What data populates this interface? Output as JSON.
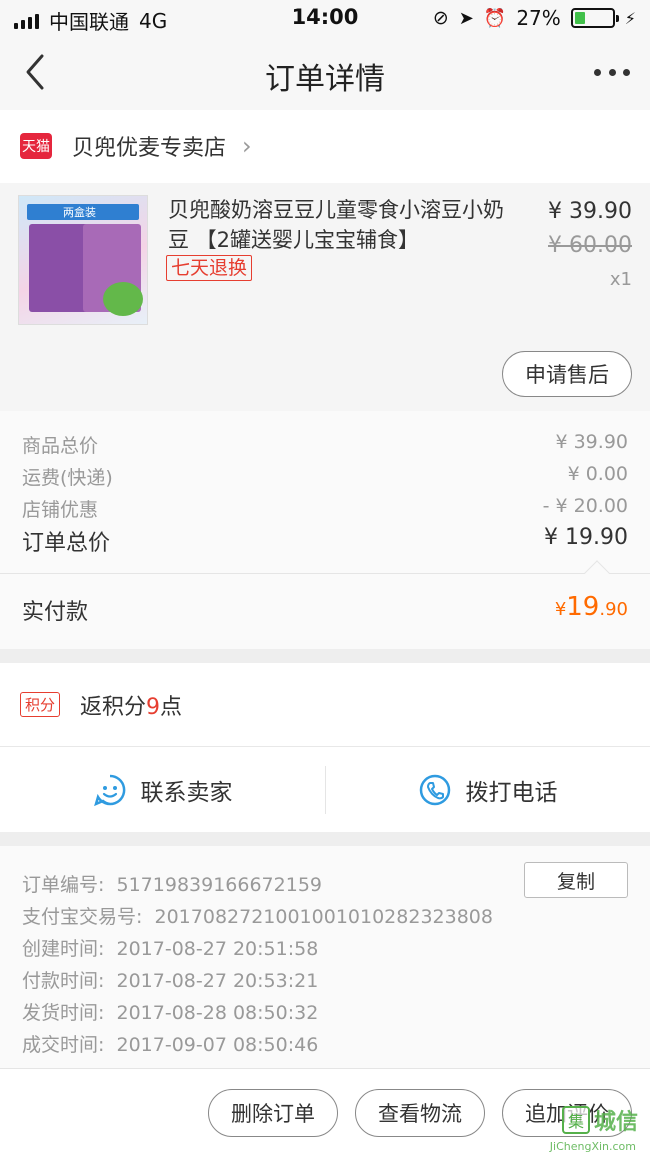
{
  "status_bar": {
    "carrier": "中国联通",
    "network": "4G",
    "time": "14:00",
    "battery": "27%",
    "battery_level": 0.27
  },
  "nav": {
    "title": "订单详情"
  },
  "store": {
    "badge": "天猫",
    "name": "贝兜优麦专卖店"
  },
  "product": {
    "title": "贝兜酸奶溶豆豆儿童零食小溶豆小奶豆 【2罐送婴儿宝宝辅食】",
    "tag": "七天退换",
    "price": "¥ 39.90",
    "original_price": "¥ 60.00",
    "quantity": "x1",
    "thumb_text": "两盒装",
    "after_sale_label": "申请售后"
  },
  "summary": {
    "rows": [
      {
        "label": "商品总价",
        "value": "¥ 39.90"
      },
      {
        "label": "运费(快递)",
        "value": "¥ 0.00"
      },
      {
        "label": "店铺优惠",
        "value": "- ¥ 20.00"
      }
    ],
    "total_label": "订单总价",
    "total_value": "¥ 19.90",
    "paid_label": "实付款",
    "paid_currency": "¥",
    "paid_int": "19",
    "paid_dec": ".90"
  },
  "points": {
    "badge": "积分",
    "text_prefix": "返积分",
    "num": "9",
    "text_suffix": "点"
  },
  "contact": {
    "seller_label": "联系卖家",
    "phone_label": "拨打电话"
  },
  "order_info": {
    "copy_label": "复制",
    "rows": [
      {
        "label": "订单编号:",
        "value": "51719839166672159"
      },
      {
        "label": "支付宝交易号:",
        "value": "2017082721001001010282323808"
      },
      {
        "label": "创建时间:",
        "value": "2017-08-27 20:51:58"
      },
      {
        "label": "付款时间:",
        "value": "2017-08-27 20:53:21"
      },
      {
        "label": "发货时间:",
        "value": "2017-08-28 08:50:32"
      },
      {
        "label": "成交时间:",
        "value": "2017-09-07 08:50:46"
      }
    ]
  },
  "footer": {
    "delete_label": "删除订单",
    "logistics_label": "查看物流",
    "review_label": "追加评价"
  },
  "watermark": {
    "logo": "集",
    "text": "城信",
    "sub": "JiChengXin.com"
  },
  "colors": {
    "accent_red": "#e63e30",
    "pay_orange": "#ff6a00",
    "icon_blue": "#2f9be0",
    "battery_green": "#41c04a"
  }
}
